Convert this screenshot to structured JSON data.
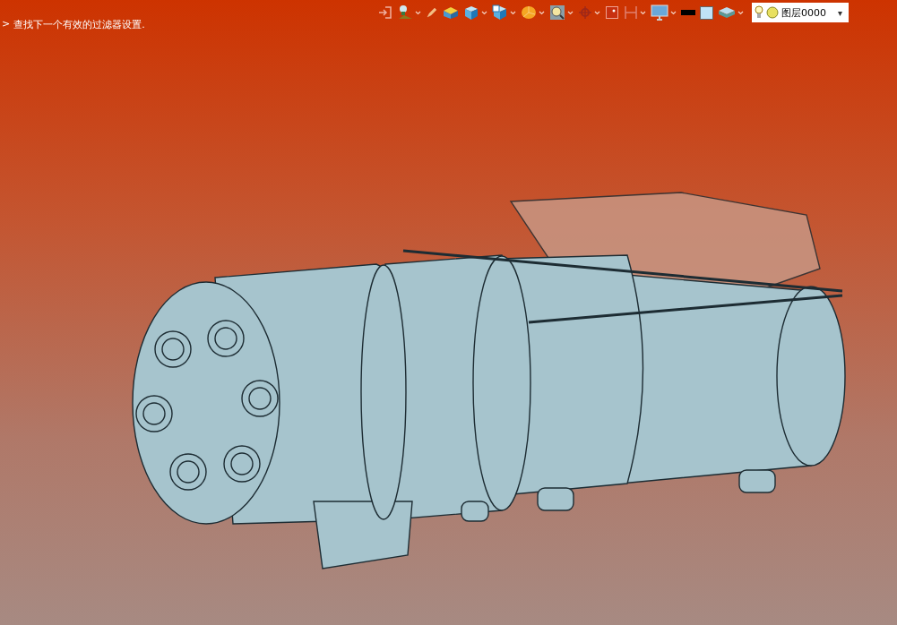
{
  "command_line": {
    "prompt": ">",
    "message": "查找下一个有效的过滤器设置."
  },
  "toolbar": {
    "items": [
      {
        "kind": "exit",
        "dropdown": false
      },
      {
        "kind": "lamp",
        "dropdown": true
      },
      {
        "kind": "pencil",
        "dropdown": false
      },
      {
        "kind": "box",
        "dropdown": false
      },
      {
        "kind": "cube",
        "dropdown": true
      },
      {
        "kind": "cube-screen",
        "dropdown": true
      },
      {
        "kind": "pie",
        "dropdown": true
      },
      {
        "kind": "magnifier",
        "dropdown": true
      },
      {
        "kind": "crosshair",
        "dropdown": true
      },
      {
        "kind": "frame",
        "dropdown": false
      },
      {
        "kind": "bracket",
        "dropdown": true
      },
      {
        "kind": "monitor",
        "dropdown": true
      },
      {
        "kind": "line-swatch",
        "dropdown": false
      },
      {
        "kind": "fill-swatch",
        "dropdown": false
      },
      {
        "kind": "layers",
        "dropdown": true
      }
    ]
  },
  "layer_select": {
    "value": "图层0000",
    "caret": "▾"
  }
}
